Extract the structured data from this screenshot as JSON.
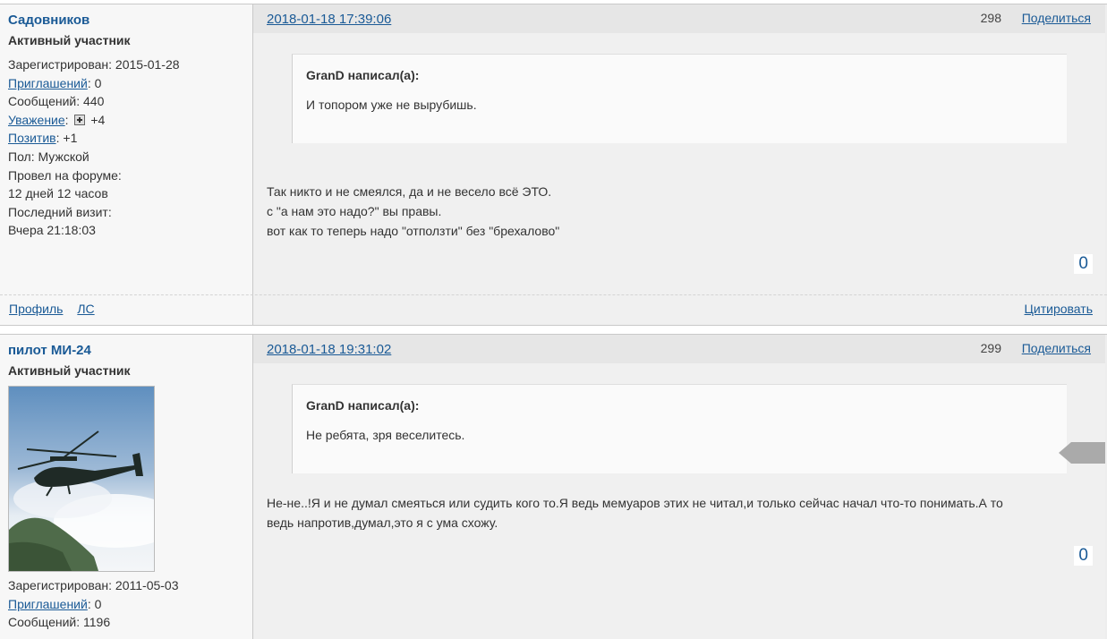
{
  "posts": [
    {
      "author": "Садовников",
      "rank": "Активный участник",
      "registered_label": "Зарегистрирован:",
      "registered": "2015-01-28",
      "invites_label": "Приглашений",
      "invites": ": 0",
      "messages_label": "Сообщений:",
      "messages": "440",
      "respect_label": "Уважение",
      "respect": "+4",
      "positive_label": "Позитив",
      "positive": ": +1",
      "gender": "Пол: Мужской",
      "time_label": "Провел на форуме:",
      "time_value": "12 дней 12 часов",
      "last_visit_label": "Последний визит:",
      "last_visit": "Вчера 21:18:03",
      "profile_link": "Профиль",
      "pm_link": "ЛС",
      "date": "2018-01-18 17:39:06",
      "number": "298",
      "share": "Поделиться",
      "quote_author": "GranD написал(а):",
      "quote_text": "И топором уже не вырубишь.",
      "message": [
        "Так никто и не смеялся, да и не весело всё ЭТО.",
        "с \"а нам это надо?\" вы правы.",
        "вот как то теперь надо \"отползти\" без \"брехалово\""
      ],
      "rating": "0",
      "cite": "Цитировать"
    },
    {
      "author": "пилот МИ-24",
      "rank": "Активный участник",
      "registered_label": "Зарегистрирован:",
      "registered": "2011-05-03",
      "invites_label": "Приглашений",
      "invites": ": 0",
      "messages_label": "Сообщений:",
      "messages": "1196",
      "date": "2018-01-18 19:31:02",
      "number": "299",
      "share": "Поделиться",
      "quote_author": "GranD написал(а):",
      "quote_text": "Не ребята, зря веселитесь.",
      "message": [
        "Не-не..!Я и не думал смеяться или судить кого то.Я ведь мемуаров этих не читал,и только сейчас начал что-то понимать.А то",
        "ведь напротив,думал,это я с ума схожу."
      ],
      "rating": "0"
    }
  ]
}
